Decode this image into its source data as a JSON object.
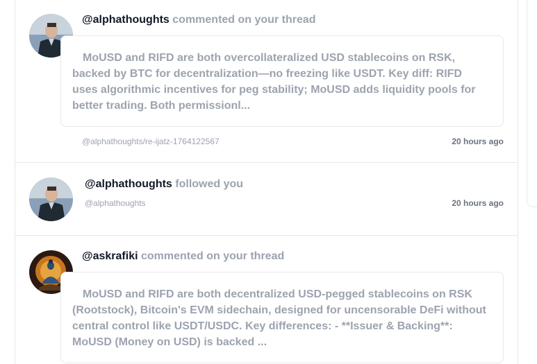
{
  "notifications": [
    {
      "user": "@alphathoughts",
      "action": "commented on your thread",
      "excerpt": "MoUSD and RIFD are both overcollateralized USD stablecoins on RSK, backed by BTC for decentralization—no freezing like USDT. Key diff: RIFD uses algorithmic incentives for peg stability; MoUSD adds liquidity pools for better trading. Both permissionl...",
      "permlink": "@alphathoughts/re-ijatz-1764122567",
      "time": "20 hours ago"
    },
    {
      "user": "@alphathoughts",
      "action": "followed you",
      "permlink": "@alphathoughts",
      "time": "20 hours ago"
    },
    {
      "user": "@askrafiki",
      "action": "commented on your thread",
      "excerpt": "MoUSD and RIFD are both decentralized USD-pegged stablecoins on RSK (Rootstock), Bitcoin's EVM sidechain, designed for uncensorable DeFi without central control like USDT/USDC. Key differences: - **Issuer & Backing**: MoUSD (Money on USD) is backed ..."
    }
  ],
  "colors": {
    "muted": "#9ca3af",
    "border": "#e5e7eb",
    "text": "#111827"
  }
}
